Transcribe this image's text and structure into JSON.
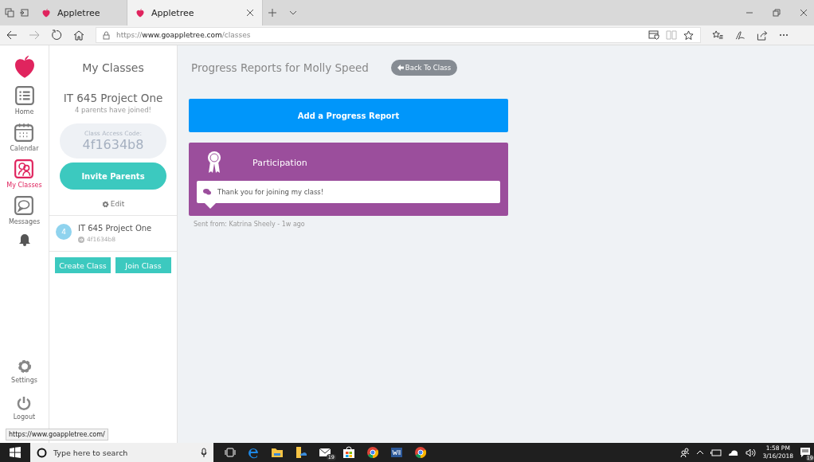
{
  "browser": {
    "tabs": [
      {
        "title": "Appletree",
        "selected": false
      },
      {
        "title": "Appletree",
        "selected": true
      }
    ],
    "url_prefix": "https://",
    "url_host": "www.goappletree.com",
    "url_path": "/classes",
    "status_url": "https://www.goappletree.com/"
  },
  "nav": {
    "items": [
      {
        "label": "Home",
        "selected": false
      },
      {
        "label": "Calendar",
        "selected": false
      },
      {
        "label": "My Classes",
        "selected": true
      },
      {
        "label": "Messages",
        "selected": false
      }
    ],
    "bottom_items": [
      {
        "label": "Settings"
      },
      {
        "label": "Logout"
      }
    ]
  },
  "class_panel": {
    "heading": "My Classes",
    "class_name": "IT 645 Project One",
    "joined": "4 parents have joined!",
    "code_label": "Class Access Code:",
    "code": "4f1634b8",
    "invite_button": "Invite Parents",
    "edit": "Edit",
    "classes": [
      {
        "badge": "4",
        "name": "IT 645 Project One",
        "code": "4f1634b8"
      }
    ],
    "create_button": "Create Class",
    "join_button": "Join Class"
  },
  "main": {
    "title": "Progress Reports for Molly Speed",
    "back_button": "Back To Class",
    "add_button": "Add a Progress Report",
    "reports": [
      {
        "category": "Participation",
        "message": "Thank you for joining my class!",
        "sent": "Sent from: Katrina Sheely - 1w ago"
      }
    ]
  },
  "taskbar": {
    "search_placeholder": "Type here to search",
    "mail_badge": "19",
    "time": "1:58 PM",
    "date": "3/16/2018",
    "notification_badge": "19"
  }
}
